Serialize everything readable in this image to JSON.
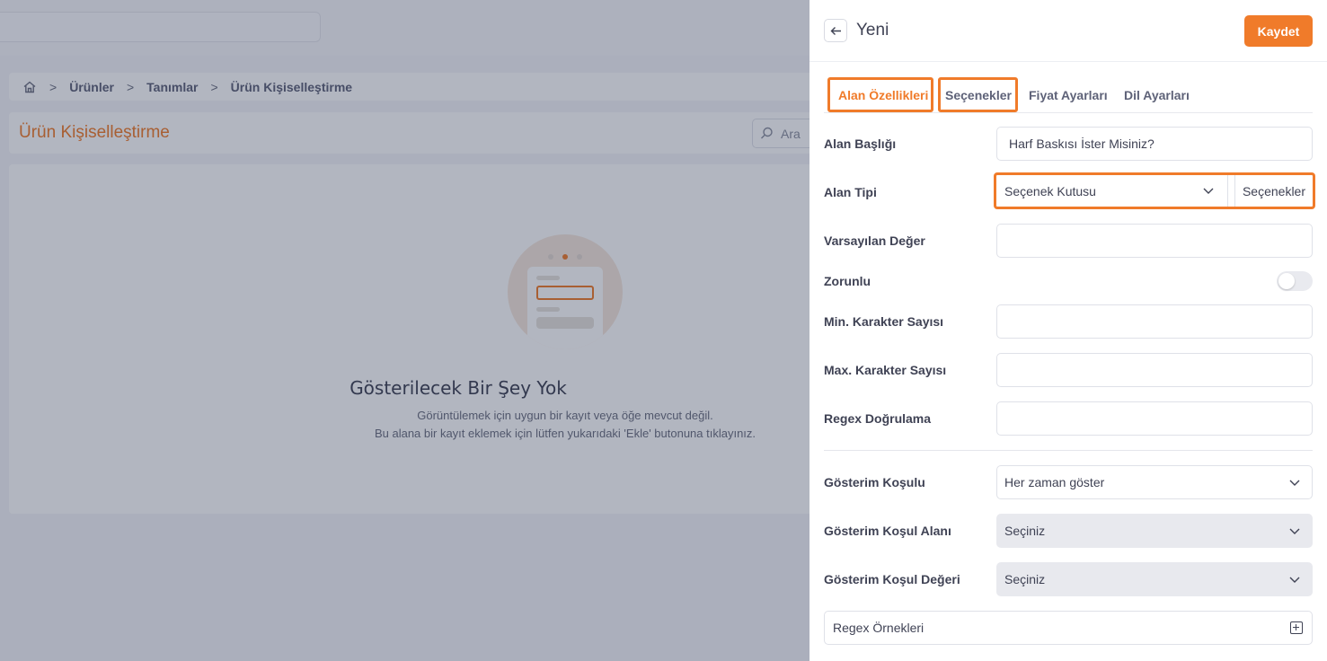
{
  "breadcrumb": {
    "items": [
      "Ürünler",
      "Tanımlar",
      "Ürün Kişiselleştirme"
    ]
  },
  "page": {
    "title": "Ürün Kişiselleştirme",
    "search_placeholder": "Ara"
  },
  "empty_state": {
    "title": "Gösterilecek Bir Şey Yok",
    "line1": "Görüntülemek için uygun bir kayıt veya öğe mevcut değil.",
    "line2": "Bu alana bir kayıt eklemek için lütfen yukarıdaki 'Ekle' butonuna tıklayınız."
  },
  "drawer": {
    "title": "Yeni",
    "save_label": "Kaydet",
    "tabs": [
      "Alan Özellikleri",
      "Seçenekler",
      "Fiyat Ayarları",
      "Dil Ayarları"
    ],
    "fields": {
      "alan_basligi": {
        "label": "Alan Başlığı",
        "value": "Harf Baskısı İster Misiniz?"
      },
      "alan_tipi": {
        "label": "Alan Tipi",
        "value": "Seçenek Kutusu",
        "button": "Seçenekler"
      },
      "varsayilan_deger": {
        "label": "Varsayılan Değer",
        "value": ""
      },
      "zorunlu": {
        "label": "Zorunlu",
        "on": false
      },
      "min_karakter": {
        "label": "Min. Karakter Sayısı",
        "value": ""
      },
      "max_karakter": {
        "label": "Max. Karakter Sayısı",
        "value": ""
      },
      "regex": {
        "label": "Regex Doğrulama",
        "value": ""
      },
      "gosterim_kosulu": {
        "label": "Gösterim Koşulu",
        "value": "Her zaman göster"
      },
      "gosterim_kosul_alani": {
        "label": "Gösterim Koşul Alanı",
        "value": "Seçiniz"
      },
      "gosterim_kosul_degeri": {
        "label": "Gösterim Koşul Değeri",
        "value": "Seçiniz"
      }
    },
    "regex_examples": "Regex Örnekleri"
  },
  "colors": {
    "accent": "#f07b2a",
    "overlay": "rgba(30,40,70,0.34)"
  }
}
